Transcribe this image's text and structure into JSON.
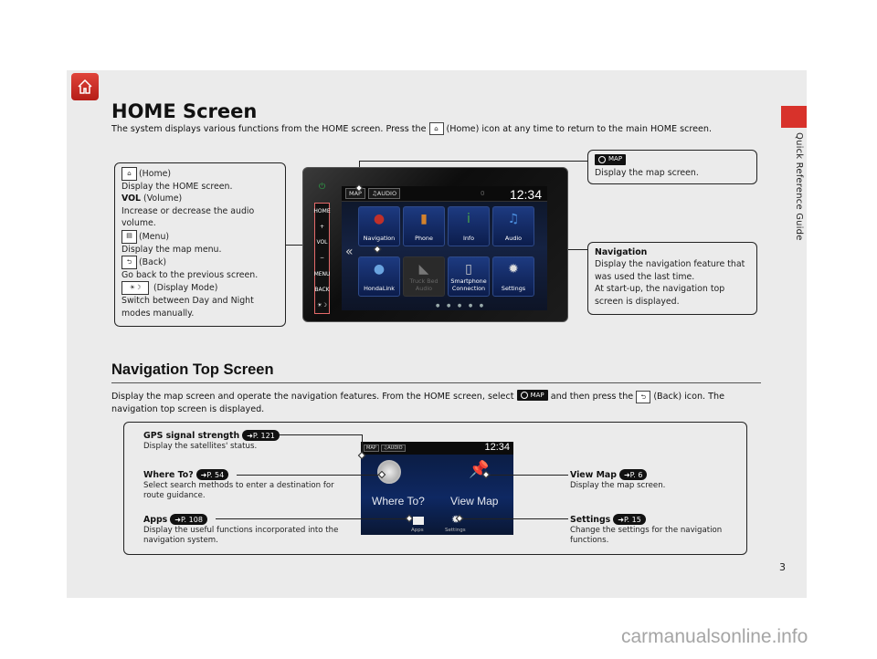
{
  "page": {
    "side_label": "Quick Reference Guide",
    "page_number": "3",
    "watermark": "carmanualsonline.info",
    "accent_color": "#d8322b"
  },
  "home_section": {
    "title": "HOME Screen",
    "intro_before": "The system displays various functions from the HOME screen. Press the",
    "intro_after": "(Home) icon at any time to return to the main HOME screen.",
    "home_icon_label": "HOME",
    "left_callout": {
      "home_label": "(Home)",
      "home_desc": "Display the HOME screen.",
      "vol_label": "VOL",
      "vol_paren": "(Volume)",
      "vol_desc": "Increase or decrease the audio volume.",
      "menu_label": "(Menu)",
      "menu_desc": "Display the map menu.",
      "back_label": "(Back)",
      "back_desc": "Go back to the previous screen.",
      "mode_label": "(Display Mode)",
      "mode_desc": "Switch between Day and Night modes manually.",
      "menu_icon_text": "MENU",
      "back_icon_text": "BACK",
      "mode_icon_text": "☀☽"
    },
    "map_callout": {
      "chip": "MAP",
      "desc": "Display the map screen."
    },
    "nav_callout": {
      "title": "Navigation",
      "desc1": "Display the navigation feature that was used the last time.",
      "desc2": "At start-up, the navigation top screen is displayed."
    },
    "unit": {
      "power_label": "AUDIO",
      "hw_buttons": [
        "HOME",
        "+",
        "VOL",
        "−",
        "MENU",
        "BACK",
        "☀☽"
      ],
      "top_buttons": [
        "MAP",
        "♫AUDIO"
      ],
      "clock": "12:34",
      "status_glyph": "0",
      "tiles": [
        {
          "label": "Navigation",
          "icon": "▲",
          "icon_color": "#c0302a",
          "disabled": false
        },
        {
          "label": "Phone",
          "icon": "▮",
          "icon_color": "#d4822c",
          "disabled": false
        },
        {
          "label": "Info",
          "icon": "i",
          "icon_color": "#4aa54a",
          "disabled": false
        },
        {
          "label": "Audio",
          "icon": "♫",
          "icon_color": "#4b8fe0",
          "disabled": false
        },
        {
          "label": "HondaLink",
          "icon": "●",
          "icon_color": "#6aa4e0",
          "disabled": false
        },
        {
          "label": "Truck Bed Audio",
          "icon": "◣",
          "icon_color": "#777",
          "disabled": true
        },
        {
          "label": "Smartphone Connection",
          "icon": "▯",
          "icon_color": "#ccc",
          "disabled": false
        },
        {
          "label": "Settings",
          "icon": "✹",
          "icon_color": "#ddd",
          "disabled": false
        }
      ],
      "pager": "● ● ● ● ●",
      "chevron": "«"
    }
  },
  "nav_section": {
    "title": "Navigation Top Screen",
    "desc_part1": "Display the map screen and operate the navigation features. From the HOME screen, select",
    "desc_chip": "MAP",
    "desc_part2": "and then press the",
    "desc_part3": "(Back) icon. The navigation top screen is displayed.",
    "features": [
      {
        "title": "GPS signal strength",
        "ref": "P. 121",
        "desc": "Display the satellites' status."
      },
      {
        "title": "Where To?",
        "ref": "P. 54",
        "desc": "Select search methods to enter a destination for route guidance."
      },
      {
        "title": "Apps",
        "ref": "P. 108",
        "desc": "Display the useful functions incorporated into the navigation system."
      },
      {
        "title": "View Map",
        "ref": "P. 6",
        "desc": "Display the map screen."
      },
      {
        "title": "Settings",
        "ref": "P. 15",
        "desc": "Change the settings for the navigation functions."
      }
    ],
    "screen": {
      "top_buttons": [
        "MAP",
        "♫AUDIO"
      ],
      "clock": "12:34",
      "where_to": "Where To?",
      "view_map": "View Map",
      "apps": "Apps",
      "settings": "Settings"
    }
  }
}
